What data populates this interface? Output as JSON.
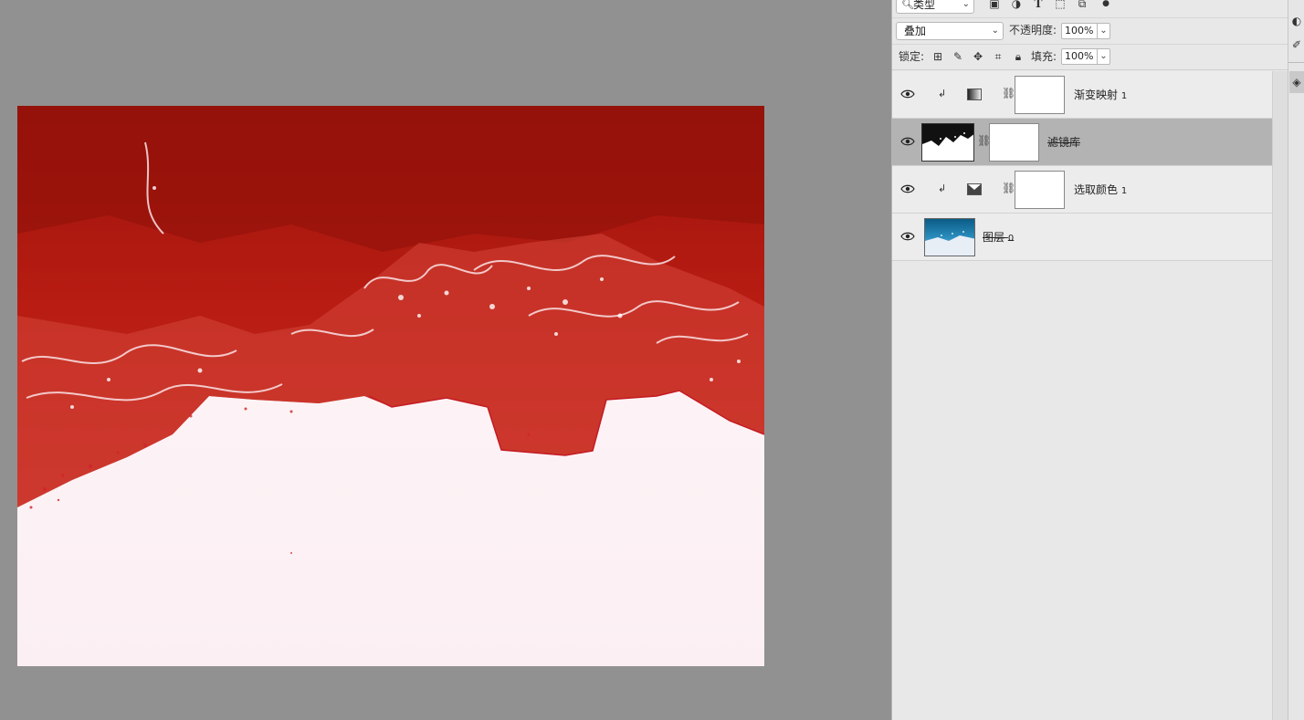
{
  "layers_panel": {
    "filter": {
      "kind_label": "类型"
    },
    "blend_mode": "叠加",
    "opacity": {
      "label": "不透明度:",
      "value": "100%"
    },
    "lock": {
      "label": "锁定:"
    },
    "fill": {
      "label": "填充:",
      "value": "100%"
    },
    "layers": [
      {
        "name": "渐变映射",
        "suffix": "1",
        "type": "gradient-map-adjustment",
        "clipped": true,
        "visible": true,
        "selected": false
      },
      {
        "name": "滤镜库",
        "suffix": "",
        "type": "smart-filter-layer",
        "clipped": false,
        "visible": true,
        "selected": true
      },
      {
        "name": "选取颜色",
        "suffix": "1",
        "type": "selective-color-adjustment",
        "clipped": true,
        "visible": true,
        "selected": false
      },
      {
        "name": "图层",
        "suffix": "0",
        "type": "image-layer",
        "clipped": false,
        "visible": true,
        "selected": false
      }
    ]
  },
  "colors": {
    "canvas_bg": "#919191",
    "image_red": "#b2180f",
    "image_white": "#fcf1f3",
    "panel_bg": "#e8e8e8",
    "selected_row": "#b3b3b3"
  }
}
